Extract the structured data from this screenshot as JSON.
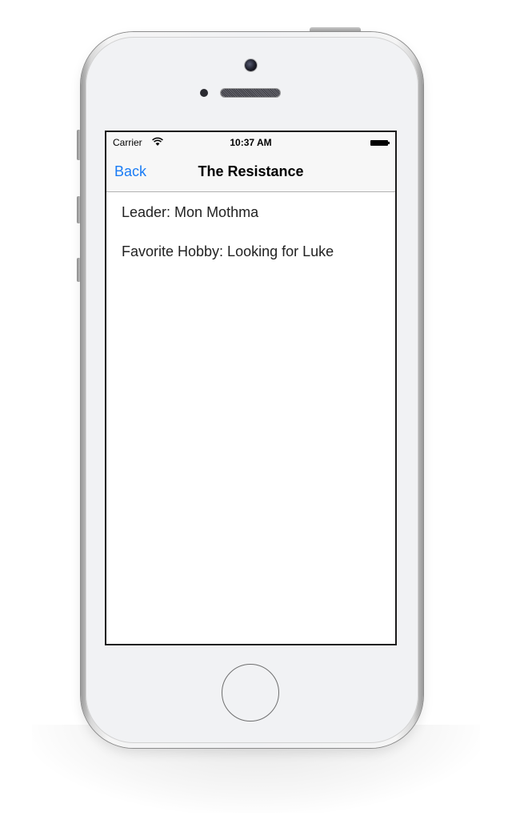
{
  "status_bar": {
    "carrier": "Carrier",
    "time": "10:37 AM",
    "wifi_icon": "wifi-icon",
    "battery_icon": "battery-icon"
  },
  "nav_bar": {
    "back_label": "Back",
    "title": "The Resistance",
    "accent_color": "#1a7cf5"
  },
  "content": {
    "rows": [
      {
        "text": "Leader: Mon Mothma"
      },
      {
        "text": "Favorite Hobby: Looking for Luke"
      }
    ]
  },
  "device": {
    "home_button_icon": "home-button-icon",
    "camera_icon": "front-camera-icon",
    "speaker_icon": "earpiece-speaker-icon"
  }
}
